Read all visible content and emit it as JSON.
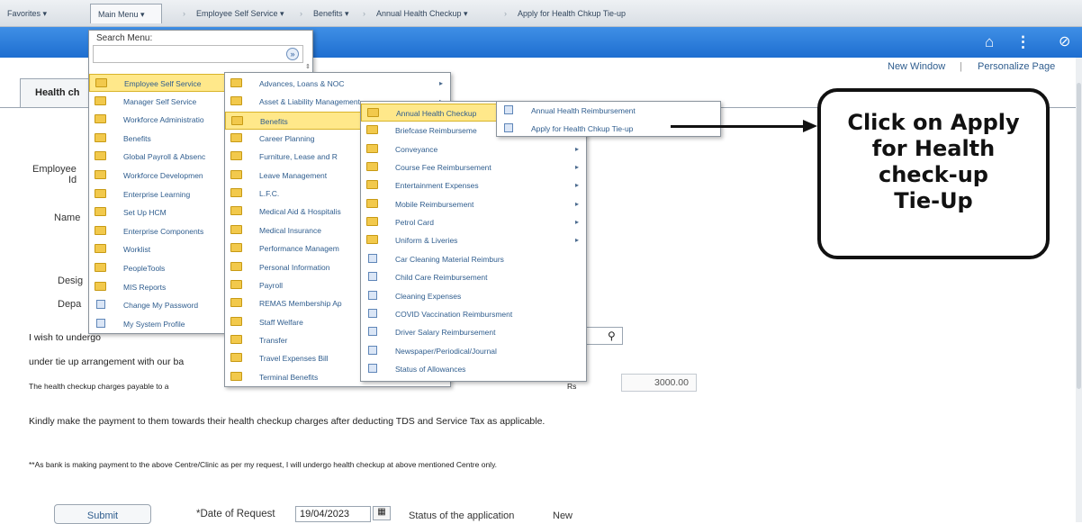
{
  "topbar": {
    "favorites": "Favorites ▾",
    "main_menu": "Main Menu ▾",
    "crumbs": [
      "Employee Self Service ▾",
      "Benefits ▾",
      "Annual Health Checkup ▾",
      "Apply for Health Chkup Tie-up"
    ]
  },
  "header_icons": [
    "home-icon",
    "more-vertical-icon",
    "navbar-icon"
  ],
  "links": {
    "new_window": "New Window",
    "personalize": "Personalize Page"
  },
  "tab": {
    "label": "Health ch"
  },
  "form_labels": {
    "employee": "Employee",
    "id": "Id",
    "name": "Name",
    "desig": "Desig",
    "depa": "Depa"
  },
  "body_text": {
    "wish": "I wish to undergo",
    "tieup": "under tie up arrangement with our ba",
    "charges": "The health checkup charges payable to a",
    "charges_tail": "Rs",
    "amount": "3000.00",
    "kindly": "Kindly make the payment to them towards their health checkup charges after deducting TDS and Service Tax as applicable.",
    "note": "**As bank is making payment to the above Centre/Clinic as per my request, I will undergo health checkup at above mentioned Centre only."
  },
  "footer": {
    "submit": "Submit",
    "date_label": "*Date of Request",
    "date_value": "19/04/2023",
    "status_label": "Status of the application",
    "status_value": "New"
  },
  "menu1": {
    "search_label": "Search Menu:",
    "items": [
      {
        "label": "Employee Self Service",
        "icon": "folder",
        "highlight": true
      },
      {
        "label": "Manager Self Service",
        "icon": "folder"
      },
      {
        "label": "Workforce Administratio",
        "icon": "folder"
      },
      {
        "label": "Benefits",
        "icon": "folder"
      },
      {
        "label": "Global Payroll & Absenc",
        "icon": "folder"
      },
      {
        "label": "Workforce Developmen",
        "icon": "folder"
      },
      {
        "label": "Enterprise Learning",
        "icon": "folder"
      },
      {
        "label": "Set Up HCM",
        "icon": "folder"
      },
      {
        "label": "Enterprise Components",
        "icon": "folder"
      },
      {
        "label": "Worklist",
        "icon": "folder"
      },
      {
        "label": "PeopleTools",
        "icon": "folder"
      },
      {
        "label": "MIS Reports",
        "icon": "folder"
      },
      {
        "label": "Change My Password",
        "icon": "page"
      },
      {
        "label": "My System Profile",
        "icon": "page"
      }
    ]
  },
  "menu2": {
    "items": [
      {
        "label": "Advances, Loans & NOC",
        "icon": "folder",
        "arrow": true
      },
      {
        "label": "Asset & Liability Management",
        "icon": "folder",
        "arrow": true
      },
      {
        "label": "Benefits",
        "icon": "folder",
        "highlight": true,
        "arrow": true
      },
      {
        "label": "Career Planning",
        "icon": "folder"
      },
      {
        "label": "Furniture, Lease and R",
        "icon": "folder"
      },
      {
        "label": "Leave Management",
        "icon": "folder"
      },
      {
        "label": "L.F.C.",
        "icon": "folder"
      },
      {
        "label": "Medical Aid & Hospitalis",
        "icon": "folder"
      },
      {
        "label": "Medical Insurance",
        "icon": "folder"
      },
      {
        "label": "Performance Managem",
        "icon": "folder"
      },
      {
        "label": "Personal Information",
        "icon": "folder"
      },
      {
        "label": "Payroll",
        "icon": "folder"
      },
      {
        "label": "REMAS Membership Ap",
        "icon": "folder"
      },
      {
        "label": "Staff Welfare",
        "icon": "folder"
      },
      {
        "label": "Transfer",
        "icon": "folder"
      },
      {
        "label": "Travel Expenses Bill",
        "icon": "folder"
      },
      {
        "label": "Terminal Benefits",
        "icon": "folder"
      }
    ]
  },
  "menu3": {
    "items": [
      {
        "label": "Annual Health Checkup",
        "icon": "folder",
        "highlight": true
      },
      {
        "label": "Briefcase Reimburseme",
        "icon": "folder"
      },
      {
        "label": "Conveyance",
        "icon": "folder",
        "arrow": true
      },
      {
        "label": "Course Fee Reimbursement",
        "icon": "folder",
        "arrow": true
      },
      {
        "label": "Entertainment Expenses",
        "icon": "folder",
        "arrow": true
      },
      {
        "label": "Mobile Reimbursement",
        "icon": "folder",
        "arrow": true
      },
      {
        "label": "Petrol Card",
        "icon": "folder",
        "arrow": true
      },
      {
        "label": "Uniform & Liveries",
        "icon": "folder",
        "arrow": true
      },
      {
        "label": "Car Cleaning Material Reimburs",
        "icon": "page"
      },
      {
        "label": "Child Care Reimbursement",
        "icon": "page"
      },
      {
        "label": "Cleaning Expenses",
        "icon": "page"
      },
      {
        "label": "COVID Vaccination Reimbursment",
        "icon": "page"
      },
      {
        "label": "Driver Salary Reimbursement",
        "icon": "page"
      },
      {
        "label": "Newspaper/Periodical/Journal",
        "icon": "page"
      },
      {
        "label": "Status of Allowances",
        "icon": "page"
      }
    ]
  },
  "menu4": {
    "items": [
      {
        "label": "Annual Health Reimbursement",
        "icon": "page"
      },
      {
        "label": "Apply for Health Chkup Tie-up",
        "icon": "page"
      }
    ]
  },
  "callout": {
    "lines": [
      "Click on Apply",
      "for Health",
      "check-up",
      "Tie-Up"
    ]
  }
}
